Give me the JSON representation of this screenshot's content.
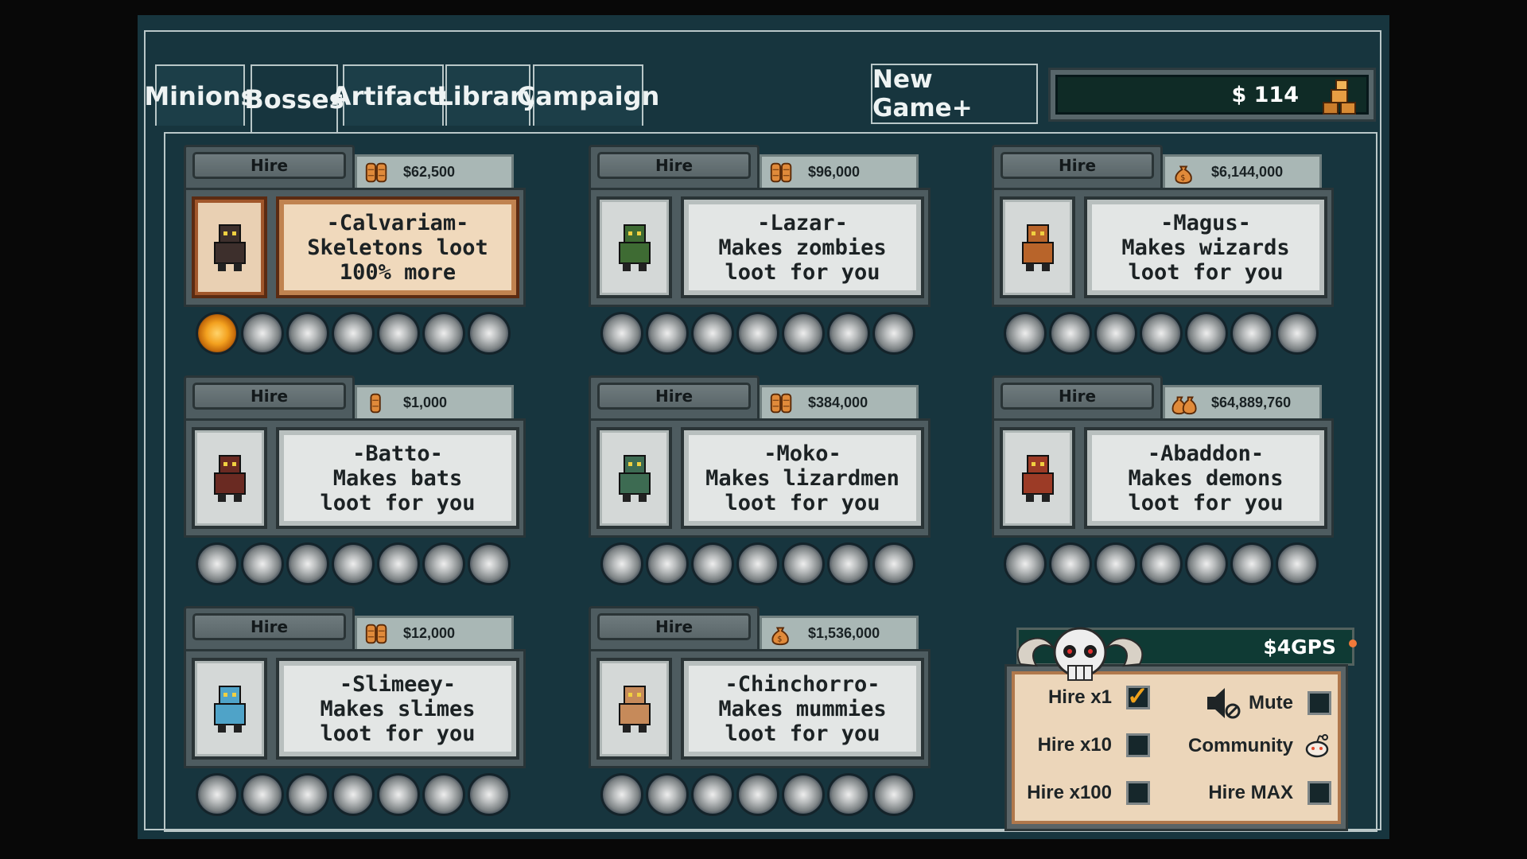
{
  "tabs": [
    {
      "label": "Minions",
      "active": false
    },
    {
      "label": "Bosses",
      "active": true
    },
    {
      "label": "Artifacts",
      "active": false
    },
    {
      "label": "Library",
      "active": false
    },
    {
      "label": "Campaign",
      "active": false
    }
  ],
  "new_game_plus": "New Game+",
  "money": "$ 114",
  "bosses": [
    {
      "hire": "Hire",
      "price": "$62,500",
      "price_icon": "coin-stack-icon",
      "name": "-Calvariam-",
      "line2": "Skeletons loot",
      "line3": "100% more",
      "highlighted": true,
      "levels_filled": 1,
      "portrait": "skeleton-boss-icon"
    },
    {
      "hire": "Hire",
      "price": "$96,000",
      "price_icon": "coin-stack-icon",
      "name": "-Lazar-",
      "line2": "Makes zombies",
      "line3": "loot for you",
      "highlighted": false,
      "levels_filled": 0,
      "portrait": "zombie-boss-icon"
    },
    {
      "hire": "Hire",
      "price": "$6,144,000",
      "price_icon": "money-bag-icon",
      "name": "-Magus-",
      "line2": "Makes wizards",
      "line3": "loot for you",
      "highlighted": false,
      "levels_filled": 0,
      "portrait": "wizard-boss-icon"
    },
    {
      "hire": "Hire",
      "price": "$1,000",
      "price_icon": "coin-icon",
      "name": "-Batto-",
      "line2": "Makes bats",
      "line3": "loot for you",
      "highlighted": false,
      "levels_filled": 0,
      "portrait": "bat-boss-icon"
    },
    {
      "hire": "Hire",
      "price": "$384,000",
      "price_icon": "coin-stack-icon",
      "name": "-Moko-",
      "line2": "Makes lizardmen",
      "line3": "loot for you",
      "highlighted": false,
      "levels_filled": 0,
      "portrait": "lizardman-boss-icon"
    },
    {
      "hire": "Hire",
      "price": "$64,889,760",
      "price_icon": "money-bags-icon",
      "name": "-Abaddon-",
      "line2": "Makes demons",
      "line3": "loot for you",
      "highlighted": false,
      "levels_filled": 0,
      "portrait": "demon-boss-icon"
    },
    {
      "hire": "Hire",
      "price": "$12,000",
      "price_icon": "coin-stack-icon",
      "name": "-Slimeey-",
      "line2": "Makes slimes",
      "line3": "loot for you",
      "highlighted": false,
      "levels_filled": 0,
      "portrait": "slime-boss-icon"
    },
    {
      "hire": "Hire",
      "price": "$1,536,000",
      "price_icon": "money-bag-icon",
      "name": "-Chinchorro-",
      "line2": "Makes mummies",
      "line3": "loot for you",
      "highlighted": false,
      "levels_filled": 0,
      "portrait": "mummy-boss-icon"
    }
  ],
  "level_slots": 7,
  "options": {
    "gps": "$4GPS",
    "hire_x1": {
      "label": "Hire x1",
      "checked": true
    },
    "hire_x10": {
      "label": "Hire x10",
      "checked": false
    },
    "hire_x100": {
      "label": "Hire x100",
      "checked": false
    },
    "mute": {
      "label": "Mute",
      "checked": false
    },
    "community": {
      "label": "Community"
    },
    "hire_max": {
      "label": "Hire MAX",
      "checked": false
    }
  },
  "colors": {
    "background": "#17353e",
    "accent_orange": "#f0a21b",
    "panel_dark_green": "#0f3a34"
  }
}
